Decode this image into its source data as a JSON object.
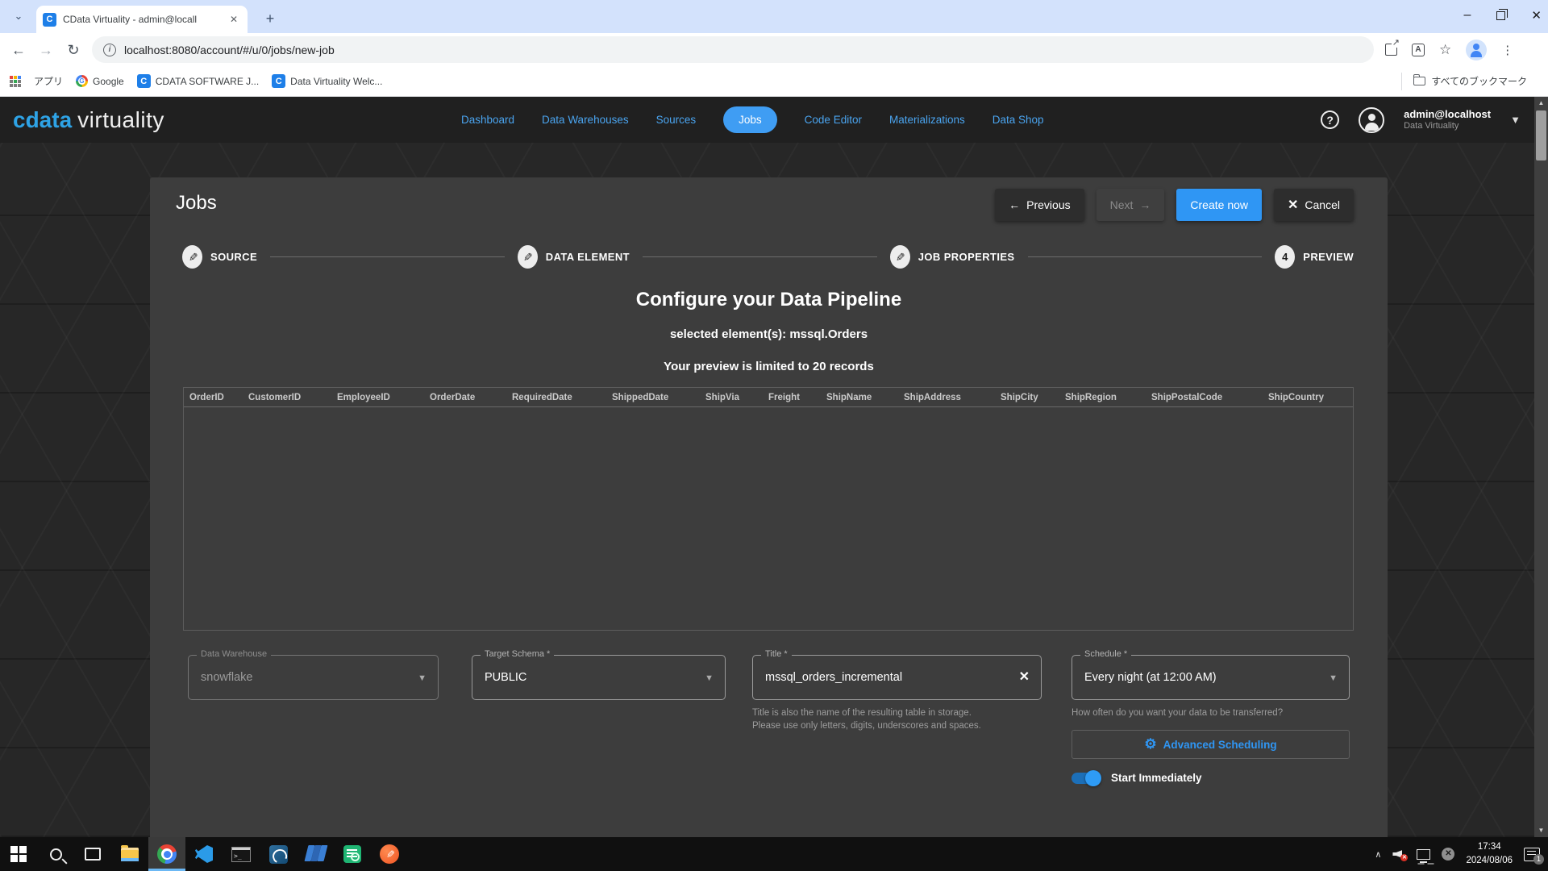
{
  "browser": {
    "tab_title": "CData Virtuality - admin@locall",
    "new_tab": "+",
    "url": "localhost:8080/account/#/u/0/jobs/new-job",
    "bookmarks": [
      {
        "label": "アプリ"
      },
      {
        "label": "Google"
      },
      {
        "label": "CDATA SOFTWARE J..."
      },
      {
        "label": "Data Virtuality Welc..."
      }
    ],
    "bookmarks_all": "すべてのブックマーク",
    "favicon_letter": "C"
  },
  "app": {
    "logo": {
      "brand": "cdata",
      "product": "virtuality"
    },
    "nav": [
      {
        "label": "Dashboard"
      },
      {
        "label": "Data Warehouses"
      },
      {
        "label": "Sources"
      },
      {
        "label": "Jobs"
      },
      {
        "label": "Code Editor"
      },
      {
        "label": "Materializations"
      },
      {
        "label": "Data Shop"
      }
    ],
    "help": "?",
    "user": {
      "name": "admin@localhost",
      "org": "Data Virtuality"
    }
  },
  "page": {
    "title": "Jobs",
    "buttons": {
      "previous": "Previous",
      "next": "Next",
      "create": "Create now",
      "cancel": "Cancel"
    },
    "steps": [
      {
        "label": "SOURCE"
      },
      {
        "label": "DATA ELEMENT"
      },
      {
        "label": "JOB PROPERTIES"
      },
      {
        "label": "PREVIEW",
        "number": "4"
      }
    ],
    "heading": "Configure your Data Pipeline",
    "subheading": "selected element(s): mssql.Orders",
    "note": "Your preview is limited to 20 records",
    "table": {
      "columns": [
        "OrderID",
        "CustomerID",
        "EmployeeID",
        "OrderDate",
        "RequiredDate",
        "ShippedDate",
        "ShipVia",
        "Freight",
        "ShipName",
        "ShipAddress",
        "ShipCity",
        "ShipRegion",
        "ShipPostalCode",
        "ShipCountry"
      ],
      "rows": []
    },
    "form": {
      "data_warehouse": {
        "label": "Data Warehouse",
        "value": "snowflake"
      },
      "target_schema": {
        "label": "Target Schema *",
        "value": "PUBLIC"
      },
      "title": {
        "label": "Title *",
        "value": "mssql_orders_incremental",
        "helper": "Title is also the name of the resulting table in storage. Please use only letters, digits, underscores and spaces."
      },
      "schedule": {
        "label": "Schedule *",
        "value": "Every night (at 12:00 AM)",
        "helper": "How often do you want your data to be transferred?"
      },
      "advanced_scheduling": "Advanced Scheduling",
      "start_immediately": "Start Immediately"
    }
  },
  "taskbar": {
    "icons": [
      "start",
      "search",
      "task-view",
      "file-explorer",
      "chrome",
      "vscode",
      "terminal",
      "pgadmin",
      "layers-app",
      "log-viewer",
      "pen-app"
    ],
    "clock": {
      "time": "17:34",
      "date": "2024/08/06"
    },
    "notification_count": "1"
  },
  "colors": {
    "accent_blue": "#2f96f4",
    "nav_blue": "#4aa4ef",
    "panel": "#3d3d3d",
    "header": "#202020",
    "tabstrip": "#d3e2fc"
  }
}
